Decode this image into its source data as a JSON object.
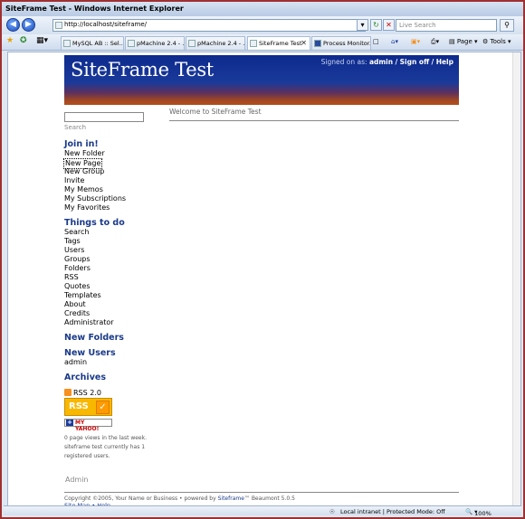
{
  "window": {
    "title": "SiteFrame Test - Windows Internet Explorer"
  },
  "address": {
    "url": "http://localhost/siteframe/",
    "search_placeholder": "Live Search"
  },
  "tabs": [
    {
      "label": "MySQL AB :: Sel..."
    },
    {
      "label": "pMachine 2.4 - ..."
    },
    {
      "label": "pMachine 2.4 - ..."
    },
    {
      "label": "SiteFrame Test"
    },
    {
      "label": "Process Monitor..."
    }
  ],
  "toolbar": {
    "page_label": "Page",
    "tools_label": "Tools"
  },
  "header": {
    "title": "SiteFrame Test",
    "signed_prefix": "Signed on as:",
    "user": "admin",
    "sign_off": "Sign off",
    "help": "Help"
  },
  "search": {
    "label": "Search"
  },
  "welcome": "Welcome to SiteFrame Test",
  "sections": {
    "join": {
      "title": "Join in!",
      "items": [
        "New Folder",
        "New Page",
        "New Group",
        "Invite",
        "My Memos",
        "My Subscriptions",
        "My Favorites"
      ]
    },
    "things": {
      "title": "Things to do",
      "items": [
        "Search",
        "Tags",
        "Users",
        "Groups",
        "Folders",
        "RSS",
        "Quotes",
        "Templates",
        "About",
        "Credits",
        "Administrator"
      ]
    },
    "new_folders": {
      "title": "New Folders"
    },
    "new_users": {
      "title": "New Users",
      "items": [
        "admin"
      ]
    },
    "archives": {
      "title": "Archives"
    }
  },
  "rss": {
    "label": "RSS 2.0",
    "badge": "RSS",
    "yahoo": "MY YAHOO!"
  },
  "stats": "0 page views in the last week. siteframe test currently has 1 registered users.",
  "admin_link": "Admin",
  "footer": {
    "copyright": "Copyright ©2005, Your Name or Business • powered by",
    "product": "Siteframe",
    "version": "™ Beaumont 5.0.5",
    "links": "Site Map • Help"
  },
  "status": {
    "zone": "Local intranet | Protected Mode: Off",
    "zoom": "100%"
  }
}
